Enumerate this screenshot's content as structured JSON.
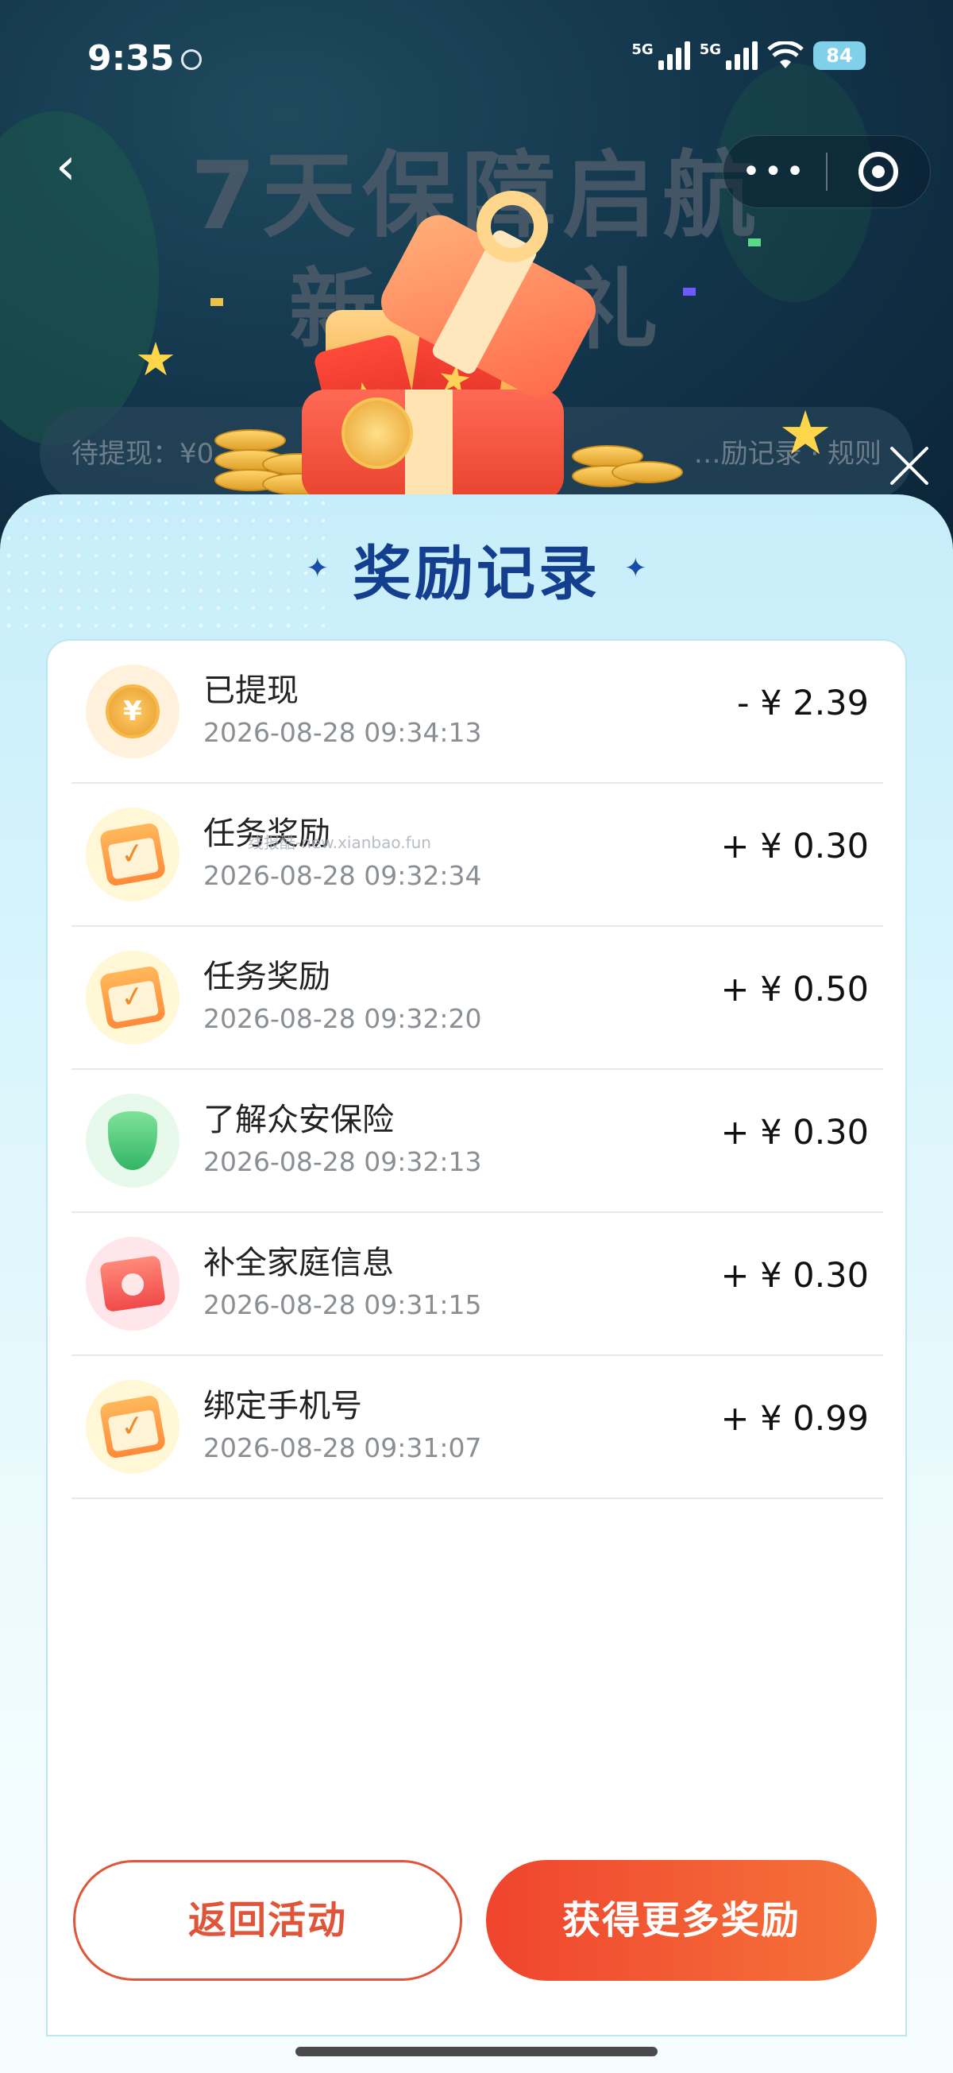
{
  "status_bar": {
    "time": "9:35",
    "signal1": "5G",
    "signal2": "5G",
    "battery": "84"
  },
  "hero": {
    "title_line1": "7天保障启航",
    "title_line2": "新人…礼",
    "info_left": "待提现：¥0",
    "info_right": "…励记录 · 规则"
  },
  "capsule": {
    "more_symbol": "•••"
  },
  "sheet": {
    "title": "奖励记录",
    "records": [
      {
        "title": "已提现",
        "time": "2026-08-28 09:34:13",
        "amount": "- ¥ 2.39",
        "icon": "coin-icon"
      },
      {
        "title": "任务奖励",
        "time": "2026-08-28 09:32:34",
        "amount": "+ ¥ 0.30",
        "icon": "calendar-check-icon"
      },
      {
        "title": "任务奖励",
        "time": "2026-08-28 09:32:20",
        "amount": "+ ¥ 0.50",
        "icon": "calendar-check-icon"
      },
      {
        "title": "了解众安保险",
        "time": "2026-08-28 09:32:13",
        "amount": "+ ¥ 0.30",
        "icon": "shield-icon"
      },
      {
        "title": "补全家庭信息",
        "time": "2026-08-28 09:31:15",
        "amount": "+ ¥ 0.30",
        "icon": "folder-user-icon"
      },
      {
        "title": "绑定手机号",
        "time": "2026-08-28 09:31:07",
        "amount": "+ ¥ 0.99",
        "icon": "calendar-check-icon"
      }
    ],
    "watermark": "线报酷-new.xianbao.fun",
    "back_button": "返回活动",
    "more_button": "获得更多奖励"
  },
  "colors": {
    "accent": "#f0442e",
    "title_blue": "#143f8f",
    "sheet_bg": "#d7f4fc"
  }
}
